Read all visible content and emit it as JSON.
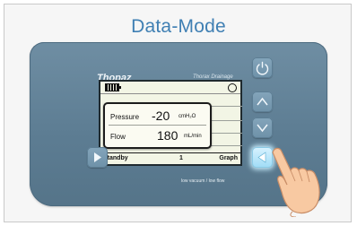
{
  "title": "Data-Mode",
  "device": {
    "brand": "Thopaz",
    "subbrand": "Thorax Drainage",
    "footnote": "low vacuum / low flow"
  },
  "screen": {
    "pressure_label": "Pressure",
    "pressure_value": "-20",
    "pressure_unit": "cmH₂O",
    "flow_label": "Flow",
    "flow_value": "180",
    "flow_unit": "mL/min",
    "status_left": "Standby",
    "status_mid": "1",
    "status_right": "Graph"
  },
  "buttons": [
    {
      "name": "power-button",
      "icon": "power-icon"
    },
    {
      "name": "up-button",
      "icon": "chevron-up-icon"
    },
    {
      "name": "down-button",
      "icon": "chevron-down-icon"
    },
    {
      "name": "left-button",
      "icon": "triangle-left-icon",
      "active": true
    },
    {
      "name": "right-button",
      "icon": "triangle-right-icon"
    }
  ],
  "colors": {
    "title": "#3f7fb3",
    "device": "#6f8ea3",
    "lcd": "#f2f5e5",
    "active_button": "#bfeaff"
  }
}
